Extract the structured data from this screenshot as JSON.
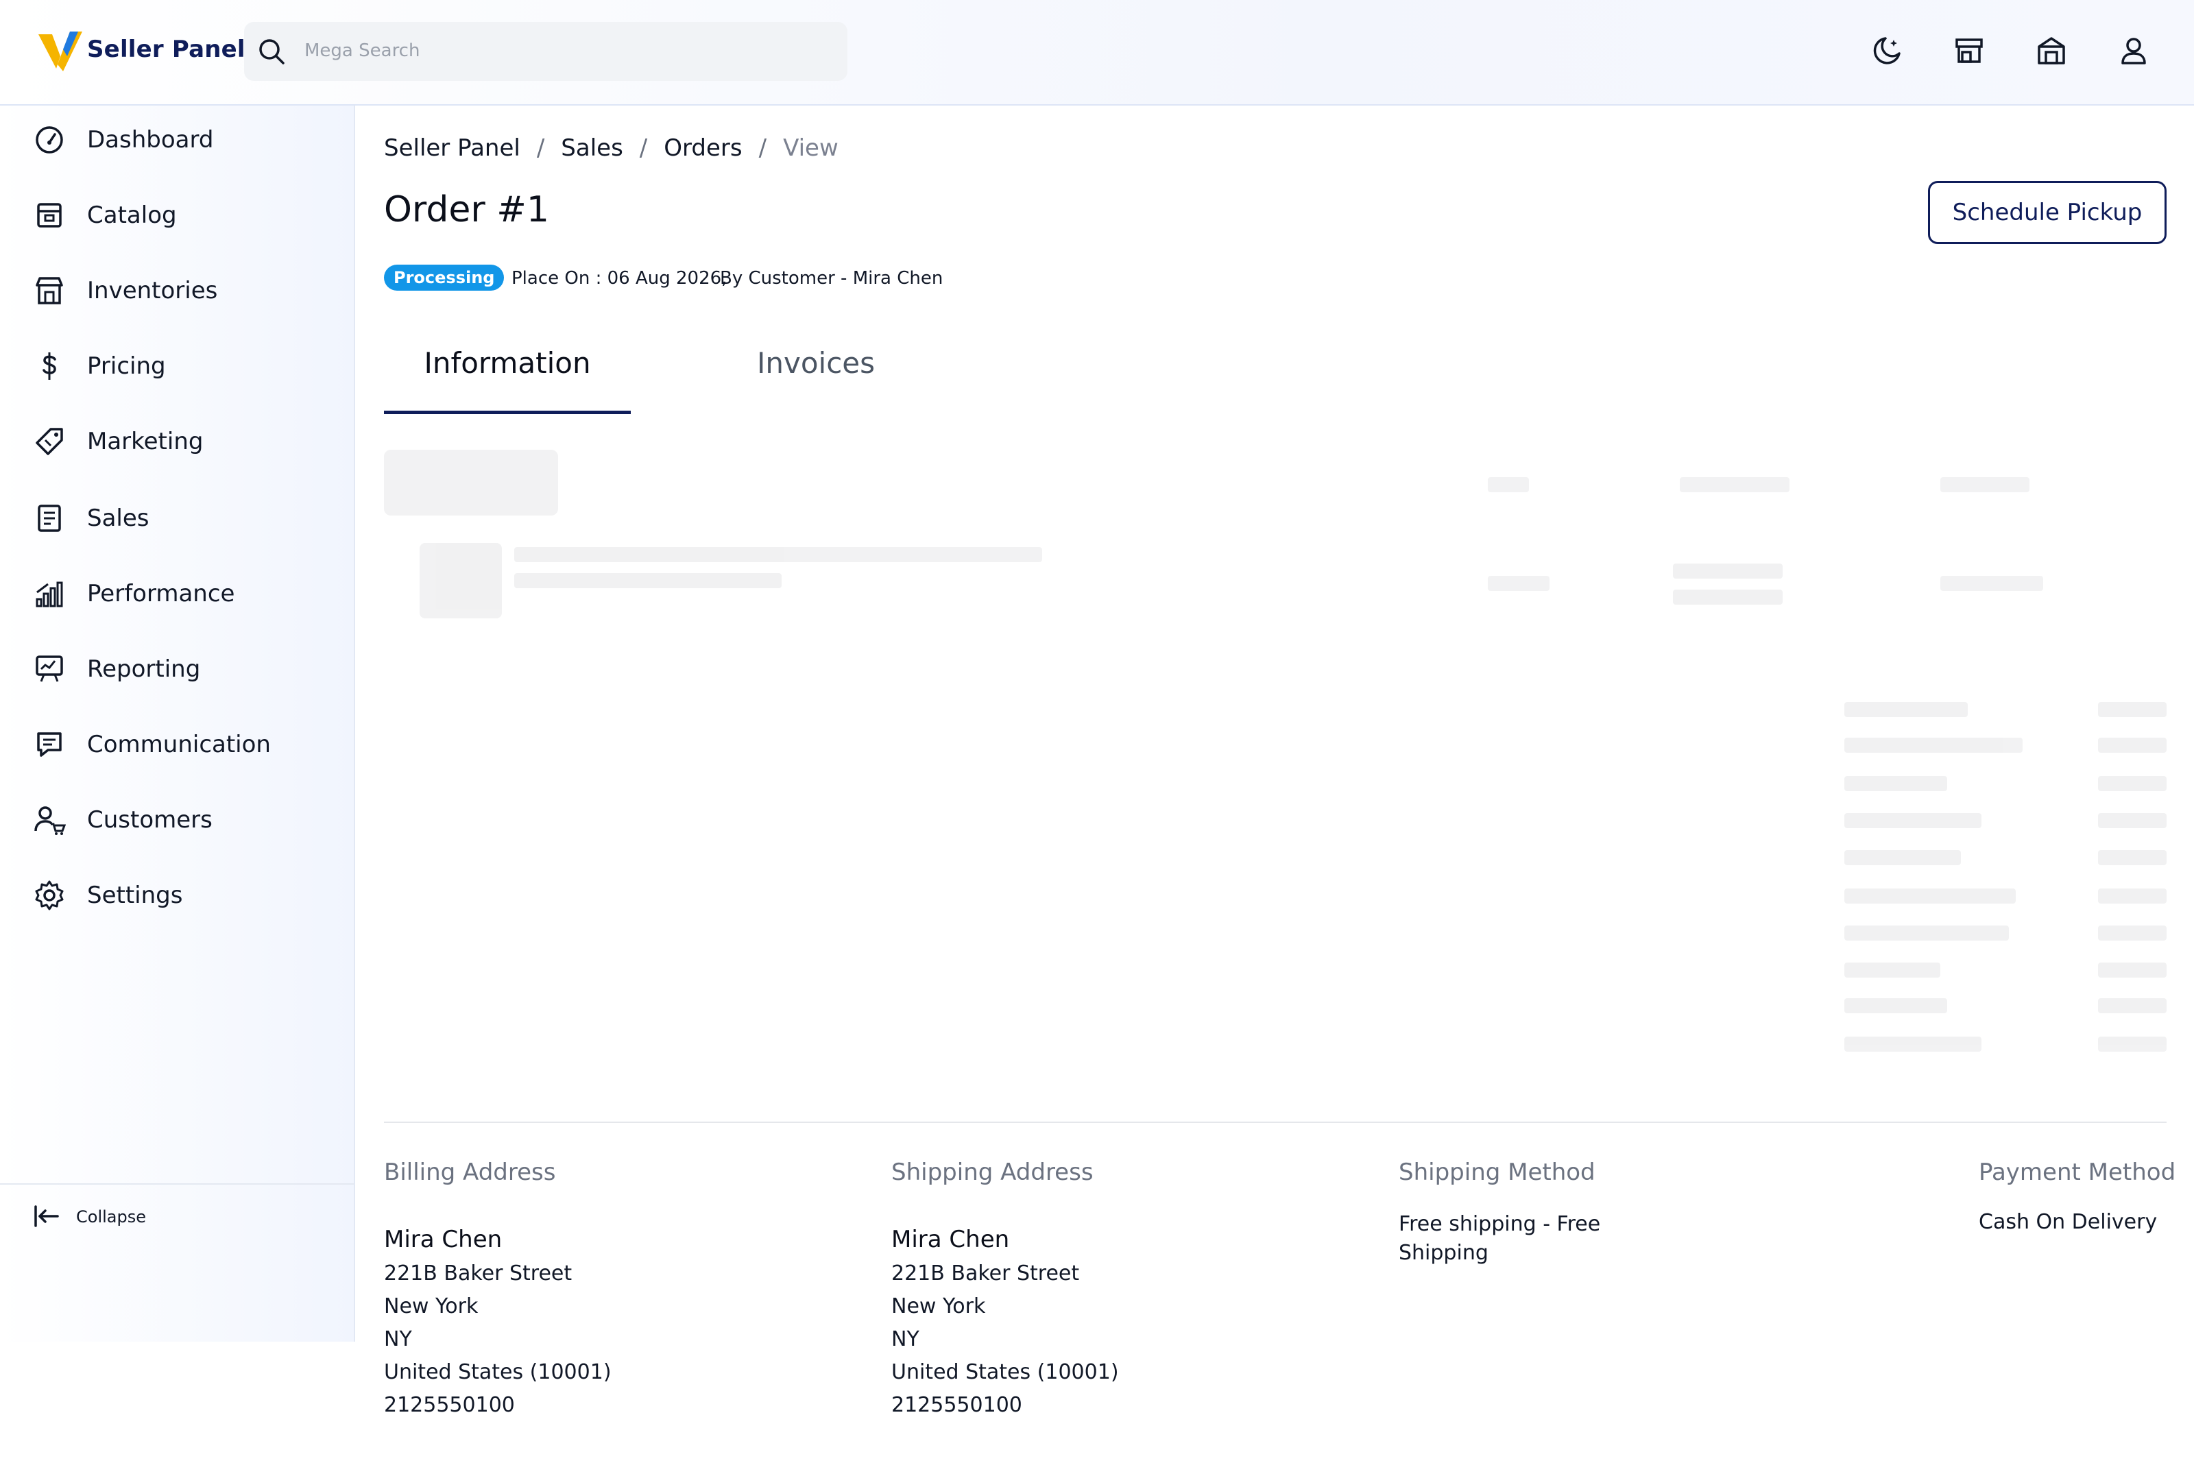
{
  "app": {
    "brand": "Seller Panel",
    "accent_color": "#0f1d5a",
    "logo_colors": [
      "#f5b400",
      "#1f7ae0"
    ]
  },
  "search": {
    "placeholder": "Mega Search"
  },
  "header_icons": [
    "theme-toggle-icon",
    "store-icon",
    "warehouse-icon",
    "user-icon"
  ],
  "sidebar": {
    "items": [
      {
        "label": "Dashboard",
        "icon": "dashboard-icon"
      },
      {
        "label": "Catalog",
        "icon": "catalog-icon"
      },
      {
        "label": "Inventories",
        "icon": "inventories-icon"
      },
      {
        "label": "Pricing",
        "icon": "pricing-icon"
      },
      {
        "label": "Marketing",
        "icon": "marketing-icon"
      },
      {
        "label": "Sales",
        "icon": "sales-icon"
      },
      {
        "label": "Performance",
        "icon": "performance-icon"
      },
      {
        "label": "Reporting",
        "icon": "reporting-icon"
      },
      {
        "label": "Communication",
        "icon": "communication-icon"
      },
      {
        "label": "Customers",
        "icon": "customers-icon"
      },
      {
        "label": "Settings",
        "icon": "settings-icon"
      }
    ],
    "collapse_label": "Collapse"
  },
  "breadcrumb": {
    "items": [
      "Seller Panel",
      "Sales",
      "Orders"
    ],
    "current": "View",
    "separator": "/"
  },
  "order": {
    "title": "Order #1",
    "status": "Processing",
    "status_color": "#1296e8",
    "placed_on": "Place On : 06 Aug 2026,",
    "by_customer": "By Customer - Mira Chen",
    "schedule_button": "Schedule Pickup"
  },
  "tabs": [
    {
      "label": "Information",
      "active": true
    },
    {
      "label": "Invoices",
      "active": false
    }
  ],
  "billing": {
    "title": "Billing Address",
    "name": "Mira Chen",
    "street": "221B Baker Street",
    "city": "New York",
    "state": "NY",
    "country": "United States (10001)",
    "phone": "2125550100"
  },
  "shipping": {
    "title": "Shipping Address",
    "name": "Mira Chen",
    "street": "221B Baker Street",
    "city": "New York",
    "state": "NY",
    "country": "United States (10001)",
    "phone": "2125550100"
  },
  "shipping_method": {
    "title": "Shipping Method",
    "value": "Free shipping - Free Shipping"
  },
  "payment_method": {
    "title": "Payment Method",
    "value": "Cash On Delivery"
  }
}
